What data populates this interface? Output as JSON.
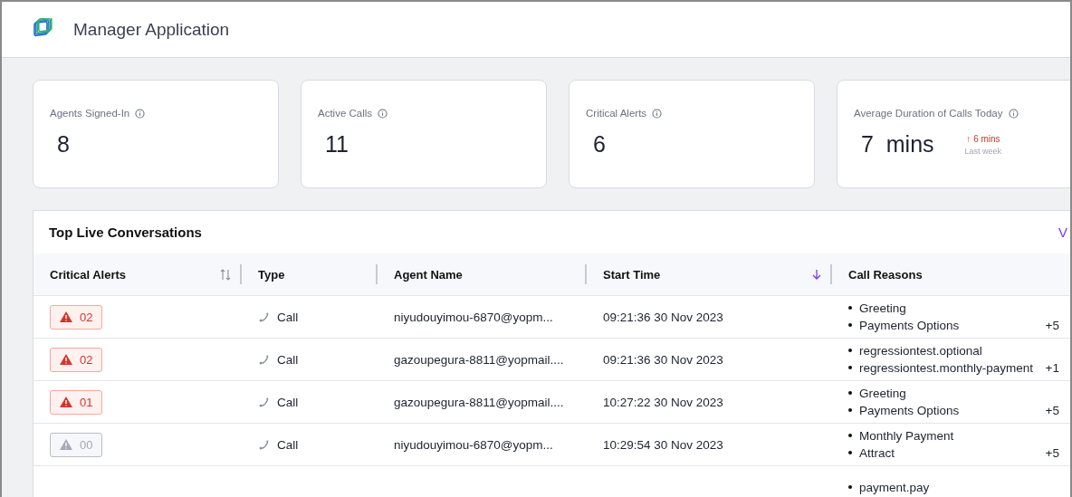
{
  "header": {
    "title": "Manager Application"
  },
  "stats": [
    {
      "label": "Agents Signed-In",
      "value": "8"
    },
    {
      "label": "Active Calls",
      "value": "11"
    },
    {
      "label": "Critical Alerts",
      "value": "6"
    },
    {
      "label": "Average Duration of Calls Today",
      "value": "7",
      "unit": "mins",
      "trend": {
        "arrow": "↑",
        "change": "6 mins",
        "period": "Last week"
      }
    }
  ],
  "conversations": {
    "title": "Top Live Conversations",
    "link": "V",
    "columns": [
      {
        "label": "Critical Alerts",
        "kind": "sortable"
      },
      {
        "label": "Type",
        "kind": "plain"
      },
      {
        "label": "Agent Name",
        "kind": "plain"
      },
      {
        "label": "Start Time",
        "kind": "sorted"
      },
      {
        "label": "Call Reasons",
        "kind": "plain"
      }
    ],
    "rows": [
      {
        "alerts": {
          "count": "02",
          "active": true
        },
        "type": "Call",
        "agent": "niyudouyimou-6870@yopm...",
        "start": "09:21:36 30 Nov 2023",
        "reasons": [
          "Greeting",
          "Payments Options"
        ],
        "more": "+5"
      },
      {
        "alerts": {
          "count": "02",
          "active": true
        },
        "type": "Call",
        "agent": "gazoupegura-8811@yopmail....",
        "start": "09:21:36 30 Nov 2023",
        "reasons": [
          "regressiontest.optional",
          "regressiontest.monthly-payment"
        ],
        "more": "+1"
      },
      {
        "alerts": {
          "count": "01",
          "active": true
        },
        "type": "Call",
        "agent": "gazoupegura-8811@yopmail....",
        "start": "10:27:22 30 Nov 2023",
        "reasons": [
          "Greeting",
          "Payments Options"
        ],
        "more": "+5"
      },
      {
        "alerts": {
          "count": "00",
          "active": false
        },
        "type": "Call",
        "agent": "niyudouyimou-6870@yopm...",
        "start": "10:29:54 30 Nov 2023",
        "reasons": [
          "Monthly Payment",
          "Attract"
        ],
        "more": "+5"
      },
      {
        "reasons": [
          "payment.pay"
        ]
      }
    ]
  }
}
